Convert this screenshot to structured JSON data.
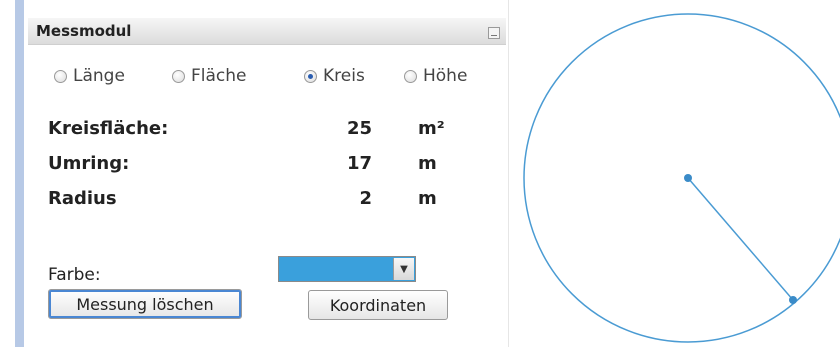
{
  "panel": {
    "title": "Messmodul"
  },
  "modes": [
    {
      "label": "Länge",
      "selected": false
    },
    {
      "label": "Fläche",
      "selected": false
    },
    {
      "label": "Kreis",
      "selected": true
    },
    {
      "label": "Höhe",
      "selected": false
    }
  ],
  "measurements": [
    {
      "label": "Kreisfläche:",
      "value": "25",
      "unit": "m²"
    },
    {
      "label": "Umring:",
      "value": "17",
      "unit": "m"
    },
    {
      "label": "Radius",
      "value": "2",
      "unit": "m"
    }
  ],
  "color": {
    "label": "Farbe:",
    "selected_color": "#3aa0dc"
  },
  "buttons": {
    "delete_label": "Messung löschen",
    "coords_label": "Koordinaten"
  },
  "canvas": {
    "stroke_color": "#4a9bd3"
  }
}
